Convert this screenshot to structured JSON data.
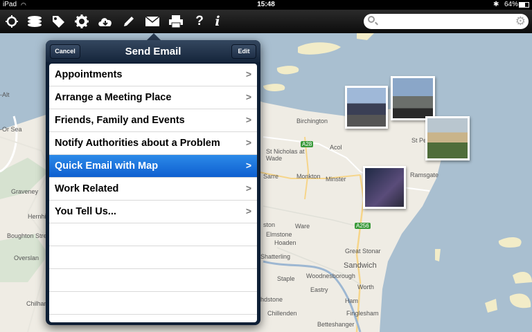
{
  "status_bar": {
    "carrier": "iPad",
    "time": "15:48",
    "battery": "64%"
  },
  "toolbar": {
    "icons": [
      "target-icon",
      "layers-icon",
      "tag-icon",
      "gear-icon",
      "cloud-download-icon",
      "pencil-icon",
      "mail-icon",
      "printer-icon",
      "help-icon",
      "info-icon"
    ],
    "help_glyph": "?",
    "info_glyph": "i",
    "search_placeholder": ""
  },
  "popover": {
    "title": "Send Email",
    "cancel_label": "Cancel",
    "edit_label": "Edit",
    "items": [
      {
        "label": "Appointments"
      },
      {
        "label": "Arrange a Meeting Place"
      },
      {
        "label": "Friends, Family and Events"
      },
      {
        "label": "Notify Authorities about a Problem"
      },
      {
        "label": "Quick Email with Map"
      },
      {
        "label": "Work Related"
      },
      {
        "label": "You Tell Us..."
      }
    ],
    "selected_index": 4
  },
  "map": {
    "labels": [
      "Birchington",
      "Acol",
      "St Nicholas at Wade",
      "Sarre",
      "Monkton",
      "Minster",
      "Ramsgate",
      "St Pe",
      "Graveney",
      "Hernhi",
      "Boughton Stre",
      "Overslan",
      "Chilhan",
      "Ware",
      "ston",
      "Elmstone",
      "Hoaden",
      "Great Stonar",
      "Sandwich",
      "Shatterling",
      "Staple",
      "Woodnesborough",
      "Worth",
      "Eastry",
      "Ham",
      "Finglesham",
      "Chillenden",
      "Betteshanger",
      "hdstone",
      "-Or Sea",
      "-Alt"
    ],
    "roads": [
      "A28",
      "A256"
    ]
  }
}
